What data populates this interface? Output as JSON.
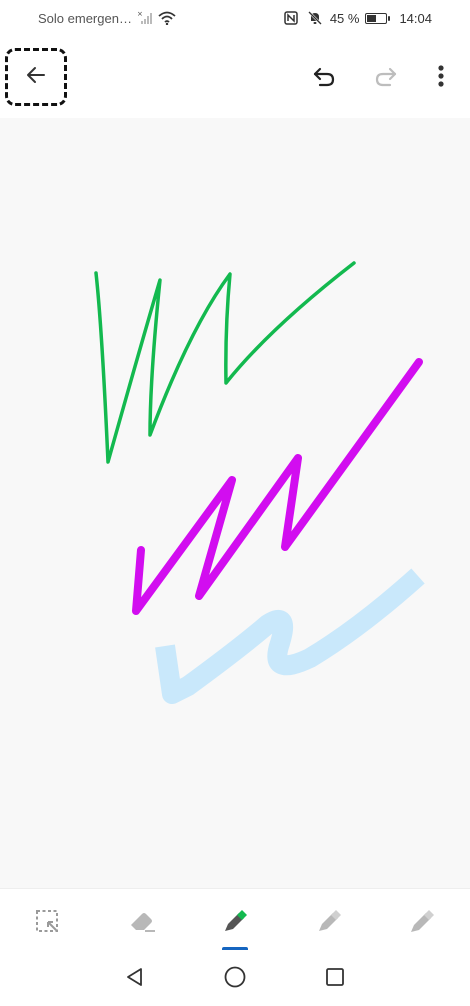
{
  "status_bar": {
    "carrier": "Solo emergen…",
    "battery_percent": "45 %",
    "time": "14:04"
  },
  "toolbar": {
    "back": "back-arrow-icon",
    "undo": "undo-icon",
    "redo": "redo-icon",
    "more": "more-vert-icon"
  },
  "canvas": {
    "background": "#f8f8f8",
    "strokes": [
      {
        "color": "#13b94f",
        "tool": "pen"
      },
      {
        "color": "#d20df0",
        "tool": "marker"
      },
      {
        "color": "#c9e8fb",
        "tool": "highlighter"
      }
    ]
  },
  "pen_bar": {
    "tools": [
      "lasso-select-icon",
      "eraser-icon",
      "pen-icon",
      "pencil-icon",
      "marker-icon"
    ],
    "active_tool": "pen-icon",
    "active_color": "#13b94f",
    "indicator_color": "#1565c0"
  },
  "nav_bar": {
    "buttons": [
      "back-triangle-icon",
      "home-circle-icon",
      "recents-square-icon"
    ]
  }
}
